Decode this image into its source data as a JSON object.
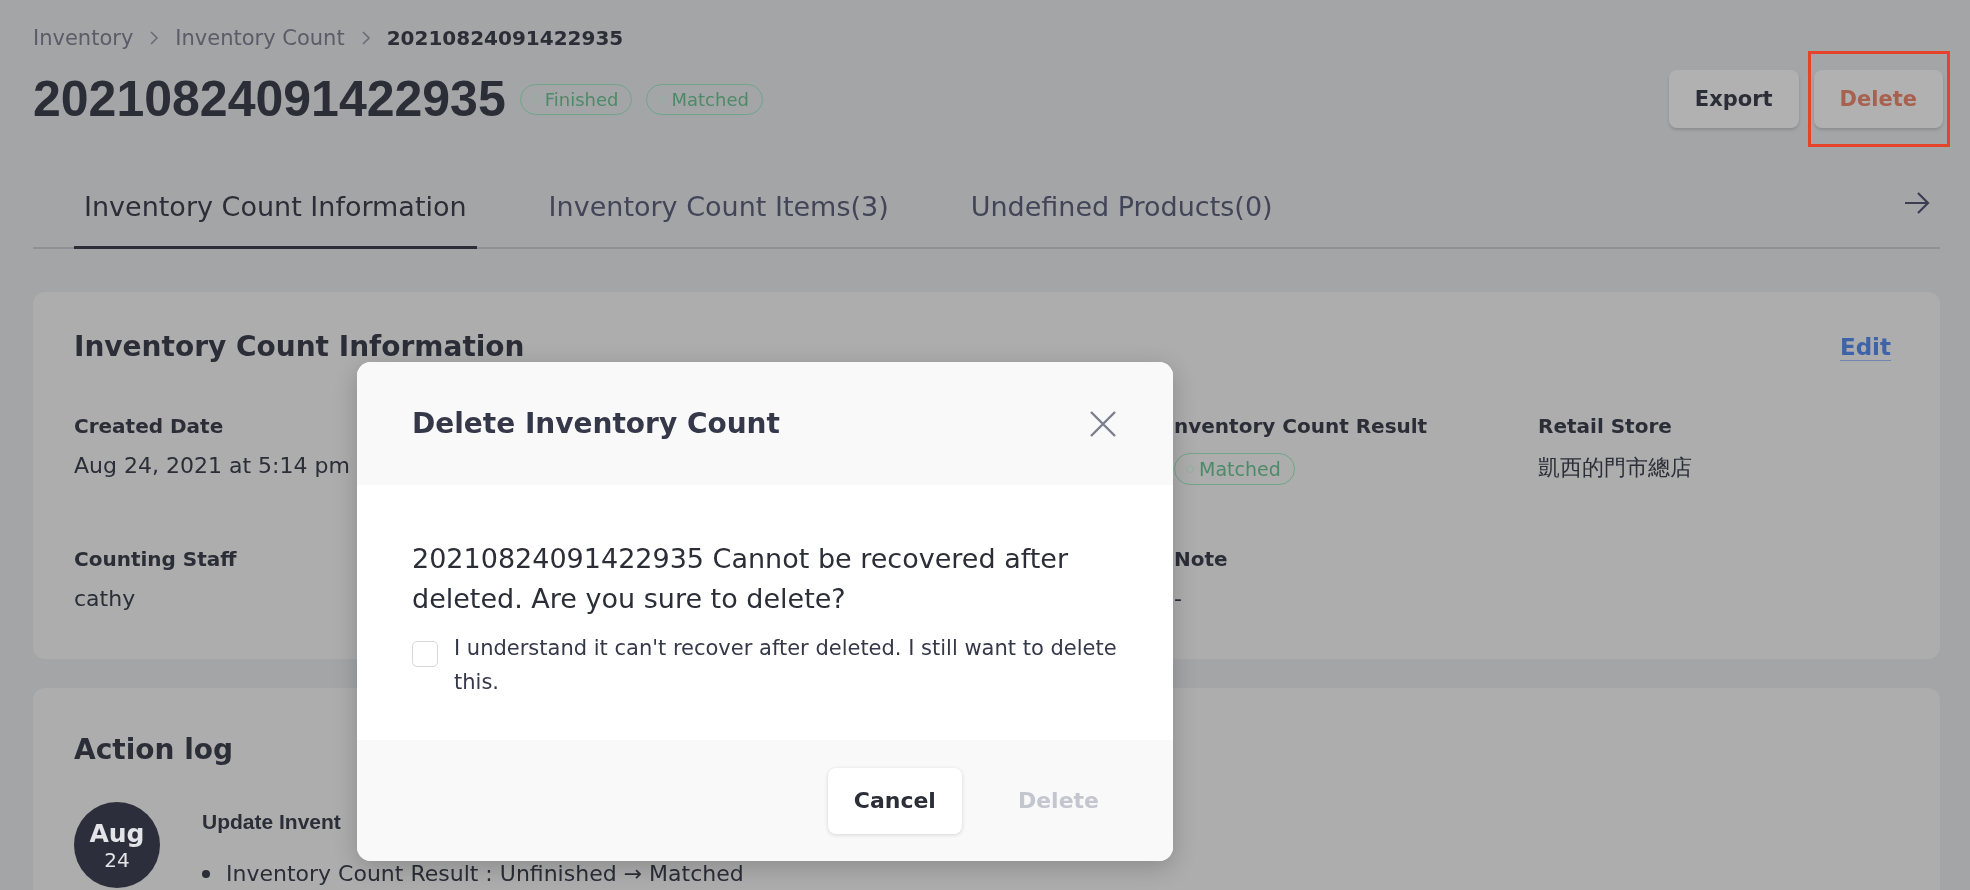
{
  "breadcrumb": [
    "Inventory",
    "Inventory Count",
    "20210824091422935"
  ],
  "title": "20210824091422935",
  "badges": [
    "Finished",
    "Matched"
  ],
  "actions": [
    {
      "label": "Export",
      "kind": "default",
      "highlighted": false
    },
    {
      "label": "Delete",
      "kind": "danger",
      "highlighted": true
    }
  ],
  "tabs": [
    {
      "label": "Inventory Count Information",
      "selected": true
    },
    {
      "label": "Inventory Count Items(3)",
      "selected": false
    },
    {
      "label": "Undefined Products(0)",
      "selected": false
    }
  ],
  "info_card": {
    "title": "Inventory Count Information",
    "edit_link": "Edit",
    "fields": [
      {
        "label": "Created Date",
        "value": "Aug 24, 2021 at 5:14 pm",
        "kind": "text"
      },
      {
        "label": "nventory Count Result",
        "value": "Matched",
        "kind": "badge"
      },
      {
        "label": "Retail Store",
        "value": "凱西的門市總店",
        "kind": "text"
      },
      {
        "label": "Counting Staff",
        "value": "cathy",
        "kind": "text"
      },
      {
        "label": "Note",
        "value": "-",
        "kind": "text"
      }
    ]
  },
  "action_log": {
    "title": "Action log",
    "entries": [
      {
        "month": "Aug",
        "day": "24",
        "title": "Update Invent",
        "changes": [
          "Inventory Count Result : Unfinished → Matched"
        ]
      }
    ]
  },
  "dialog": {
    "title": "Delete Inventory Count",
    "message": "20210824091422935 Cannot be recovered after deleted. Are you sure to delete?",
    "confirm": {
      "label": "I understand it can't recover after deleted. I still want to delete this.",
      "checked": false
    },
    "buttons": [
      {
        "label": "Cancel",
        "kind": "secondary",
        "disabled": false
      },
      {
        "label": "Delete",
        "kind": "danger",
        "disabled": true
      }
    ]
  }
}
